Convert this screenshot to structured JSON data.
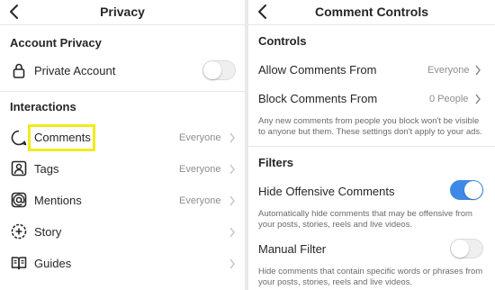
{
  "left": {
    "title": "Privacy",
    "account_privacy": {
      "heading": "Account Privacy",
      "private_account_label": "Private Account",
      "private_account_on": false
    },
    "interactions": {
      "heading": "Interactions",
      "items": [
        {
          "label": "Comments",
          "value": "Everyone",
          "icon": "comment-bubble-icon"
        },
        {
          "label": "Tags",
          "value": "Everyone",
          "icon": "tag-person-icon"
        },
        {
          "label": "Mentions",
          "value": "Everyone",
          "icon": "at-sign-icon"
        },
        {
          "label": "Story",
          "value": "",
          "icon": "story-add-icon"
        },
        {
          "label": "Guides",
          "value": "",
          "icon": "guides-book-icon"
        }
      ]
    },
    "highlight_color": "#f2ea1d"
  },
  "right": {
    "title": "Comment Controls",
    "controls": {
      "heading": "Controls",
      "allow_label": "Allow Comments From",
      "allow_value": "Everyone",
      "block_label": "Block Comments From",
      "block_value": "0 People",
      "note_line1": "Any new comments from people you block won't be visible",
      "note_line2": "to anyone but them. These settings don't apply to your ads."
    },
    "filters": {
      "heading": "Filters",
      "hide_offensive_label": "Hide Offensive Comments",
      "hide_offensive_on": true,
      "hide_offensive_note_line1": "Automatically hide comments that may be offensive from",
      "hide_offensive_note_line2": "your posts, stories, reels and live videos.",
      "manual_filter_label": "Manual Filter",
      "manual_filter_on": false,
      "manual_note_line1": "Hide comments that contain specific words or phrases from",
      "manual_note_line2": "your posts, stories, reels and live videos."
    },
    "toggle_on_color": "#3d89e8"
  }
}
